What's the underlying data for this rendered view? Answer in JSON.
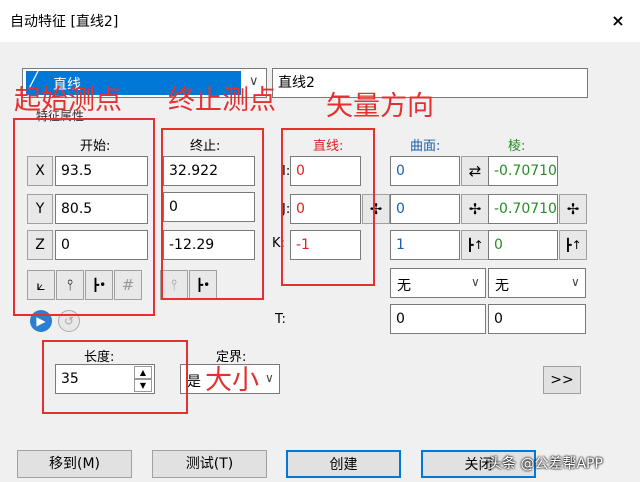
{
  "window": {
    "title": "自动特征 [直线2]",
    "close_icon": "×"
  },
  "feature": {
    "type": "直线",
    "name": "直线2"
  },
  "group_label": "特征属性",
  "start": {
    "header": "开始:",
    "x_label": "X",
    "y_label": "Y",
    "z_label": "Z",
    "x": "93.5",
    "y": "80.5",
    "z": "0"
  },
  "end": {
    "header": "终止:",
    "x": "32.922",
    "y": "0",
    "z": "-12.29"
  },
  "line": {
    "header": "直线:",
    "i_label": "I:",
    "j_label": "J:",
    "k_label": "K:",
    "i": "0",
    "j": "0",
    "k": "-1"
  },
  "surface": {
    "header": "曲面:",
    "i": "0",
    "j": "0",
    "k": "1",
    "dropdown": "无",
    "t": "0"
  },
  "edge": {
    "header": "棱:",
    "i": "-0.70710",
    "j": "-0.70710",
    "k": "0",
    "dropdown": "无",
    "t": "0"
  },
  "t_label": "T:",
  "length": {
    "label": "长度:",
    "value": "35"
  },
  "bound": {
    "label": "定界:",
    "value": "是"
  },
  "expand_label": ">>",
  "buttons": {
    "move": "移到(M)",
    "test": "测试(T)",
    "create": "创建",
    "close": "关闭"
  },
  "annotations": {
    "start_point": "起始测点",
    "end_point": "终止测点",
    "vector": "矢量方向",
    "size": "大小"
  },
  "watermark": "头条 @公差帮APP",
  "colors": {
    "annotation": "#e53030",
    "blue": "#1a5fb4",
    "green": "#2a8a2a"
  }
}
